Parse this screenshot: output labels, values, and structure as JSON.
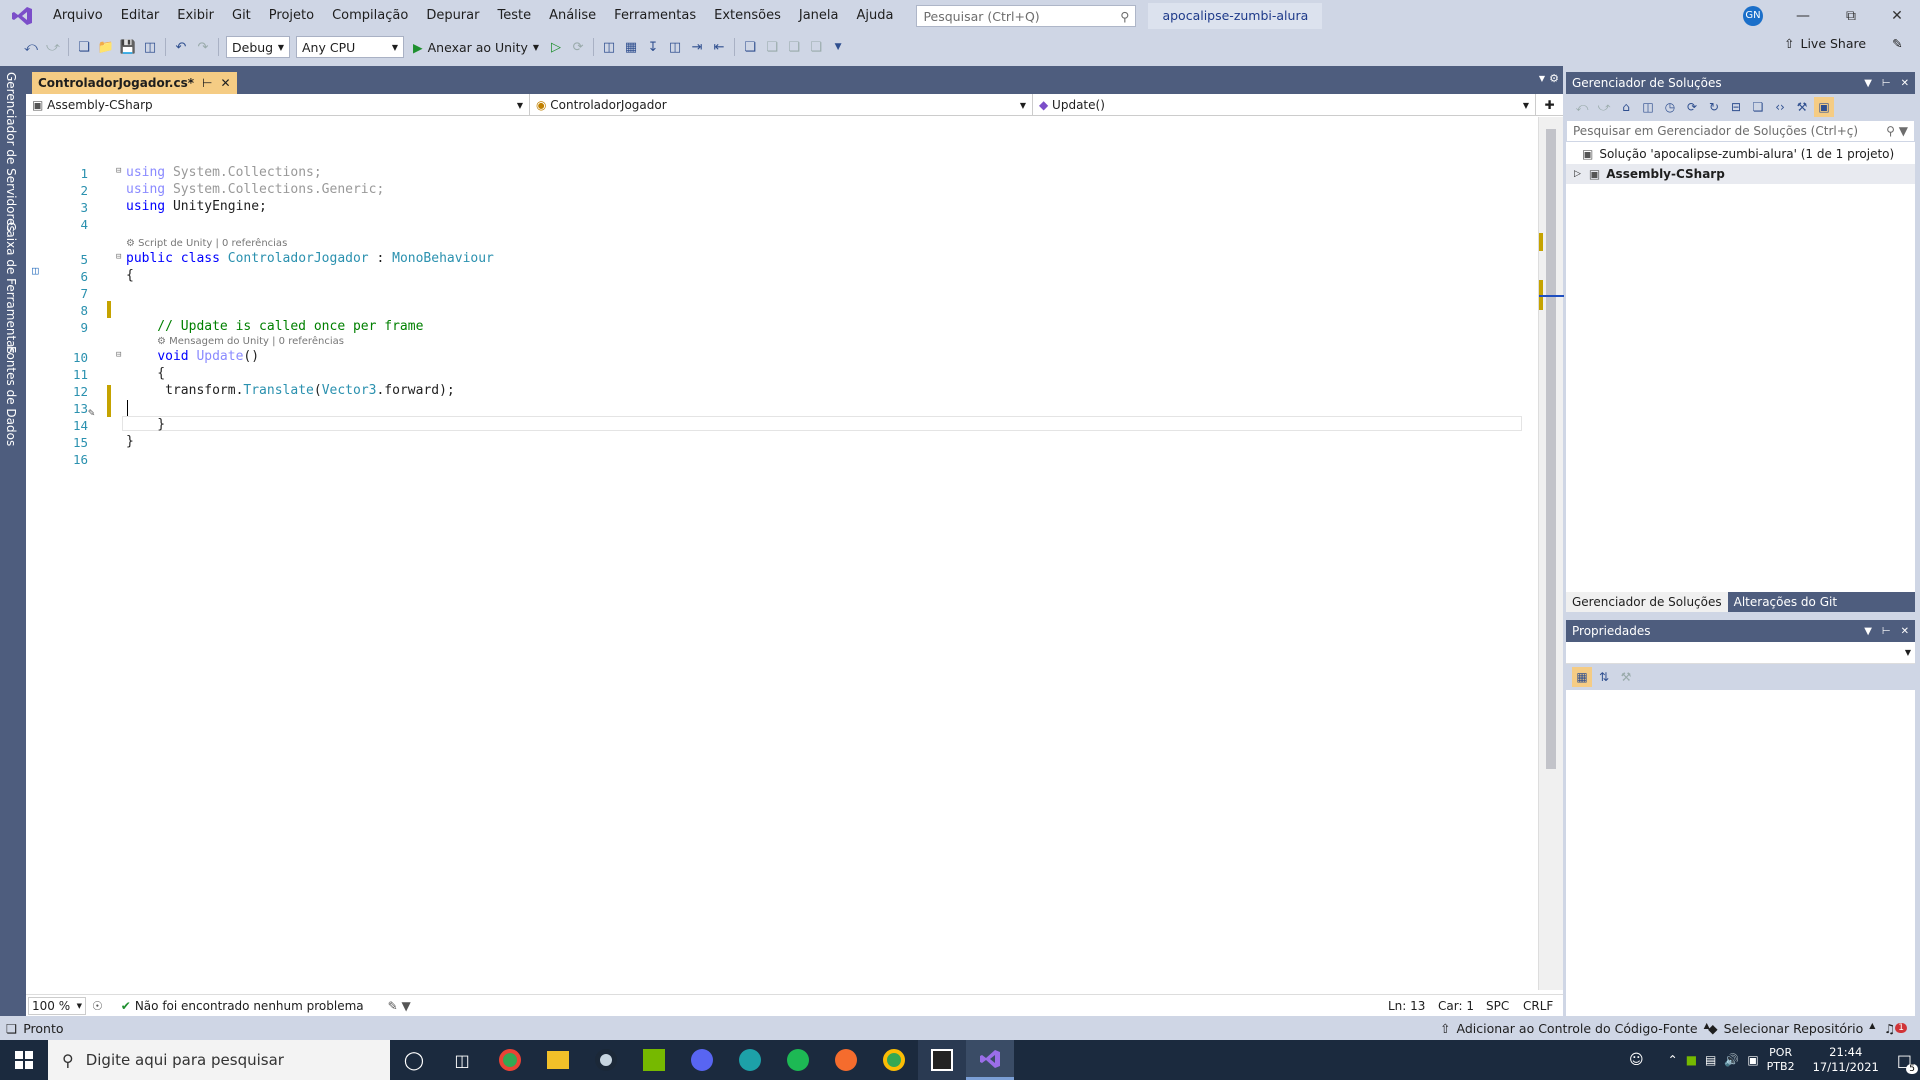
{
  "menu": {
    "items": [
      "Arquivo",
      "Editar",
      "Exibir",
      "Git",
      "Projeto",
      "Compilação",
      "Depurar",
      "Teste",
      "Análise",
      "Ferramentas",
      "Extensões",
      "Janela",
      "Ajuda"
    ],
    "search_placeholder": "Pesquisar (Ctrl+Q)",
    "solution_name": "apocalipse-zumbi-alura",
    "account_initials": "GN"
  },
  "toolbar": {
    "config": "Debug",
    "platform": "Any CPU",
    "attach_label": "Anexar ao Unity",
    "live_share": "Live Share"
  },
  "left_tabs": [
    "Gerenciador de Servidores",
    "Caixa de Ferramentas",
    "Fontes de Dados"
  ],
  "editor": {
    "tab_title": "ControladorJogador.cs*",
    "nav": {
      "project": "Assembly-CSharp",
      "class": "ControladorJogador",
      "member": "Update()"
    },
    "lines": [
      {
        "n": "1",
        "text": "using System.Collections;"
      },
      {
        "n": "2",
        "text": "using System.Collections.Generic;"
      },
      {
        "n": "3",
        "text": "using UnityEngine;"
      },
      {
        "n": "4",
        "text": ""
      },
      {
        "n": "5",
        "text": "public class ControladorJogador : MonoBehaviour"
      },
      {
        "n": "6",
        "text": "{"
      },
      {
        "n": "7",
        "text": ""
      },
      {
        "n": "8",
        "text": ""
      },
      {
        "n": "9",
        "text": "    // Update is called once per frame"
      },
      {
        "n": "10",
        "text": "    void Update()"
      },
      {
        "n": "11",
        "text": "    {"
      },
      {
        "n": "12",
        "text": "     transform.Translate(Vector3.forward);"
      },
      {
        "n": "13",
        "text": ""
      },
      {
        "n": "14",
        "text": "    }"
      },
      {
        "n": "15",
        "text": "}"
      },
      {
        "n": "16",
        "text": ""
      }
    ],
    "codelens_class": "Script de Unity | 0 referências",
    "codelens_method": "Mensagem do Unity | 0 referências",
    "status": {
      "zoom": "100 %",
      "problems": "Não foi encontrado nenhum problema",
      "line": "Ln: 13",
      "col": "Car: 1",
      "spc": "SPC",
      "eol": "CRLF"
    }
  },
  "solution_explorer": {
    "title": "Gerenciador de Soluções",
    "search_placeholder": "Pesquisar em Gerenciador de Soluções (Ctrl+ç)",
    "solution_row": "Solução 'apocalipse-zumbi-alura' (1 de 1 projeto)",
    "project_row": "Assembly-CSharp",
    "tabs": [
      "Gerenciador de Soluções",
      "Alterações do Git"
    ]
  },
  "properties": {
    "title": "Propriedades"
  },
  "status_bar": {
    "ready": "Pronto",
    "source_control": "Adicionar ao Controle do Código-Fonte",
    "repo": "Selecionar Repositório",
    "notifications": "1"
  },
  "taskbar": {
    "search_placeholder": "Digite aqui para pesquisar",
    "lang": "POR",
    "layout": "PTB2",
    "time": "21:44",
    "date": "17/11/2021",
    "notif_count": "5",
    "colors": {
      "chrome": "#34a853",
      "files": "#f2c029",
      "steam": "#1b2838",
      "nvidia": "#76b900",
      "discord": "#5865f2",
      "edge": "#1da1a8",
      "spotify": "#1db954",
      "origin": "#f56c2d",
      "unity": "#222222",
      "vs": "#7b4ec9"
    }
  }
}
